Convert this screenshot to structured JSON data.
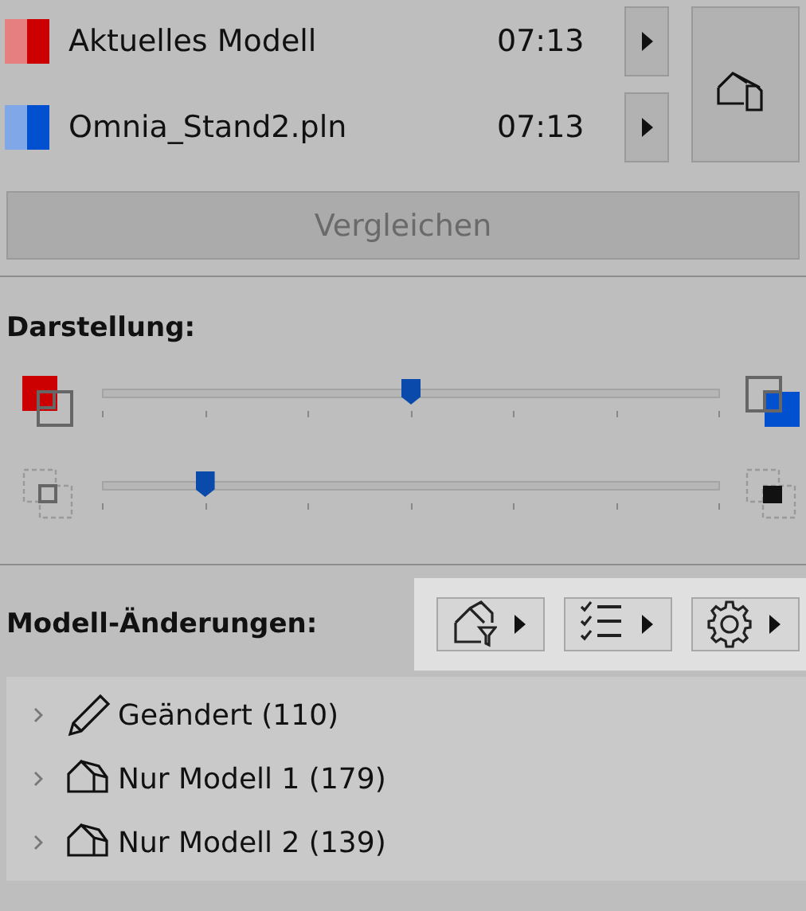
{
  "models": [
    {
      "name": "Aktuelles Modell",
      "time": "07:13",
      "color": "#cc0000"
    },
    {
      "name": "Omnia_Stand2.pln",
      "time": "07:13",
      "color": "#0050d0"
    }
  ],
  "compare_button": {
    "label": "Vergleichen",
    "disabled": true
  },
  "display": {
    "title": "Darstellung:",
    "sliders": [
      {
        "kind": "overlay",
        "level": 0.5
      },
      {
        "kind": "frame",
        "level": 0.167
      }
    ]
  },
  "changes": {
    "title": "Modell-Änderungen:",
    "tools": [
      {
        "kind": "filter"
      },
      {
        "kind": "list"
      },
      {
        "kind": "settings"
      }
    ],
    "tree": [
      {
        "label": "Geändert (110)",
        "kind": "pencil",
        "expanded": false
      },
      {
        "label": "Nur Modell 1 (179)",
        "kind": "house",
        "expanded": false
      },
      {
        "label": "Nur Modell 2 (139)",
        "kind": "house",
        "expanded": false
      }
    ]
  }
}
